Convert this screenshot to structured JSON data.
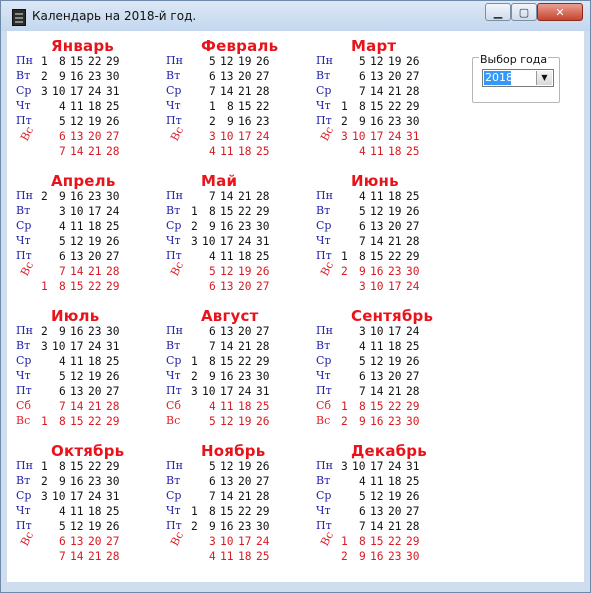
{
  "window": {
    "title": "Календарь на 2018-й год.",
    "minimize": "▁",
    "maximize": "▢",
    "close": "✕",
    "icon": "calendar-app-icon"
  },
  "year_selector": {
    "label": "Выбор года",
    "value": "2018",
    "arrow": "▼"
  },
  "weekday_labels": [
    "Пн",
    "Вт",
    "Ср",
    "Чт",
    "Пт",
    "Сб",
    "Вс"
  ],
  "colors": {
    "weekday_blue": "#2323a8",
    "weekend_red": "#d81b22",
    "month_red": "#e8141b"
  },
  "months": [
    {
      "name": "Январь",
      "weekdays": [
        "Пн",
        "Вт",
        "Ср",
        "Чт",
        "Пт",
        "Вс"
      ],
      "rows": [
        [
          "1",
          "8",
          "15",
          "22",
          "29"
        ],
        [
          "2",
          "9",
          "16",
          "23",
          "30"
        ],
        [
          "3",
          "10",
          "17",
          "24",
          "31"
        ],
        [
          "4",
          "11",
          "18",
          "25"
        ],
        [
          "5",
          "12",
          "19",
          "26"
        ],
        [
          "6",
          "13",
          "20",
          "27"
        ],
        [
          "7",
          "14",
          "21",
          "28"
        ]
      ]
    },
    {
      "name": "Февраль",
      "weekdays": [
        "Пн",
        "Вт",
        "Ср",
        "Чт",
        "Пт",
        "Вс"
      ],
      "rows": [
        [
          "5",
          "12",
          "19",
          "26"
        ],
        [
          "6",
          "13",
          "20",
          "27"
        ],
        [
          "7",
          "14",
          "21",
          "28"
        ],
        [
          "1",
          "8",
          "15",
          "22"
        ],
        [
          "2",
          "9",
          "16",
          "23"
        ],
        [
          "3",
          "10",
          "17",
          "24"
        ],
        [
          "4",
          "11",
          "18",
          "25"
        ]
      ]
    },
    {
      "name": "Март",
      "weekdays": [
        "Пн",
        "Вт",
        "Ср",
        "Чт",
        "Пт",
        "Вс"
      ],
      "rows": [
        [
          "5",
          "12",
          "19",
          "26"
        ],
        [
          "6",
          "13",
          "20",
          "27"
        ],
        [
          "7",
          "14",
          "21",
          "28"
        ],
        [
          "1",
          "8",
          "15",
          "22",
          "29"
        ],
        [
          "2",
          "9",
          "16",
          "23",
          "30"
        ],
        [
          "3",
          "10",
          "17",
          "24",
          "31"
        ],
        [
          "4",
          "11",
          "18",
          "25"
        ]
      ]
    },
    {
      "name": "Апрель",
      "weekdays": [
        "Пн",
        "Вт",
        "Ср",
        "Чт",
        "Пт",
        "Вс"
      ],
      "rows": [
        [
          "2",
          "9",
          "16",
          "23",
          "30"
        ],
        [
          "3",
          "10",
          "17",
          "24"
        ],
        [
          "4",
          "11",
          "18",
          "25"
        ],
        [
          "5",
          "12",
          "19",
          "26"
        ],
        [
          "6",
          "13",
          "20",
          "27"
        ],
        [
          "7",
          "14",
          "21",
          "28"
        ],
        [
          "1",
          "8",
          "15",
          "22",
          "29"
        ]
      ]
    },
    {
      "name": "Май",
      "weekdays": [
        "Пн",
        "Вт",
        "Ср",
        "Чт",
        "Пт",
        "Вс"
      ],
      "rows": [
        [
          "7",
          "14",
          "21",
          "28"
        ],
        [
          "1",
          "8",
          "15",
          "22",
          "29"
        ],
        [
          "2",
          "9",
          "16",
          "23",
          "30"
        ],
        [
          "3",
          "10",
          "17",
          "24",
          "31"
        ],
        [
          "4",
          "11",
          "18",
          "25"
        ],
        [
          "5",
          "12",
          "19",
          "26"
        ],
        [
          "6",
          "13",
          "20",
          "27"
        ]
      ]
    },
    {
      "name": "Июнь",
      "weekdays": [
        "Пн",
        "Вт",
        "Ср",
        "Чт",
        "Пт",
        "Вс"
      ],
      "rows": [
        [
          "4",
          "11",
          "18",
          "25"
        ],
        [
          "5",
          "12",
          "19",
          "26"
        ],
        [
          "6",
          "13",
          "20",
          "27"
        ],
        [
          "7",
          "14",
          "21",
          "28"
        ],
        [
          "1",
          "8",
          "15",
          "22",
          "29"
        ],
        [
          "2",
          "9",
          "16",
          "23",
          "30"
        ],
        [
          "3",
          "10",
          "17",
          "24"
        ]
      ]
    },
    {
      "name": "Июль",
      "weekdays": [
        "Пн",
        "Вт",
        "Ср",
        "Чт",
        "Пт",
        "Сб",
        "Вс"
      ],
      "rows": [
        [
          "2",
          "9",
          "16",
          "23",
          "30"
        ],
        [
          "3",
          "10",
          "17",
          "24",
          "31"
        ],
        [
          "4",
          "11",
          "18",
          "25"
        ],
        [
          "5",
          "12",
          "19",
          "26"
        ],
        [
          "6",
          "13",
          "20",
          "27"
        ],
        [
          "7",
          "14",
          "21",
          "28"
        ],
        [
          "1",
          "8",
          "15",
          "22",
          "29"
        ]
      ]
    },
    {
      "name": "Август",
      "weekdays": [
        "Пн",
        "Вт",
        "Ср",
        "Чт",
        "Пт",
        "Сб",
        "Вс"
      ],
      "rows": [
        [
          "6",
          "13",
          "20",
          "27"
        ],
        [
          "7",
          "14",
          "21",
          "28"
        ],
        [
          "1",
          "8",
          "15",
          "22",
          "29"
        ],
        [
          "2",
          "9",
          "16",
          "23",
          "30"
        ],
        [
          "3",
          "10",
          "17",
          "24",
          "31"
        ],
        [
          "4",
          "11",
          "18",
          "25"
        ],
        [
          "5",
          "12",
          "19",
          "26"
        ]
      ]
    },
    {
      "name": "Сентябрь",
      "weekdays": [
        "Пн",
        "Вт",
        "Ср",
        "Чт",
        "Пт",
        "Сб",
        "Вс"
      ],
      "rows": [
        [
          "3",
          "10",
          "17",
          "24"
        ],
        [
          "4",
          "11",
          "18",
          "25"
        ],
        [
          "5",
          "12",
          "19",
          "26"
        ],
        [
          "6",
          "13",
          "20",
          "27"
        ],
        [
          "7",
          "14",
          "21",
          "28"
        ],
        [
          "1",
          "8",
          "15",
          "22",
          "29"
        ],
        [
          "2",
          "9",
          "16",
          "23",
          "30"
        ]
      ]
    },
    {
      "name": "Октябрь",
      "weekdays": [
        "Пн",
        "Вт",
        "Ср",
        "Чт",
        "Пт",
        "Вс"
      ],
      "rows": [
        [
          "1",
          "8",
          "15",
          "22",
          "29"
        ],
        [
          "2",
          "9",
          "16",
          "23",
          "30"
        ],
        [
          "3",
          "10",
          "17",
          "24",
          "31"
        ],
        [
          "4",
          "11",
          "18",
          "25"
        ],
        [
          "5",
          "12",
          "19",
          "26"
        ],
        [
          "6",
          "13",
          "20",
          "27"
        ],
        [
          "7",
          "14",
          "21",
          "28"
        ]
      ]
    },
    {
      "name": "Ноябрь",
      "weekdays": [
        "Пн",
        "Вт",
        "Ср",
        "Чт",
        "Пт",
        "Вс"
      ],
      "rows": [
        [
          "5",
          "12",
          "19",
          "26"
        ],
        [
          "6",
          "13",
          "20",
          "27"
        ],
        [
          "7",
          "14",
          "21",
          "28"
        ],
        [
          "1",
          "8",
          "15",
          "22",
          "29"
        ],
        [
          "2",
          "9",
          "16",
          "23",
          "30"
        ],
        [
          "3",
          "10",
          "17",
          "24"
        ],
        [
          "4",
          "11",
          "18",
          "25"
        ]
      ]
    },
    {
      "name": "Декабрь",
      "weekdays": [
        "Пн",
        "Вт",
        "Ср",
        "Чт",
        "Пт",
        "Вс"
      ],
      "rows": [
        [
          "3",
          "10",
          "17",
          "24",
          "31"
        ],
        [
          "4",
          "11",
          "18",
          "25"
        ],
        [
          "5",
          "12",
          "19",
          "26"
        ],
        [
          "6",
          "13",
          "20",
          "27"
        ],
        [
          "7",
          "14",
          "21",
          "28"
        ],
        [
          "1",
          "8",
          "15",
          "22",
          "29"
        ],
        [
          "2",
          "9",
          "16",
          "23",
          "30"
        ]
      ]
    }
  ]
}
